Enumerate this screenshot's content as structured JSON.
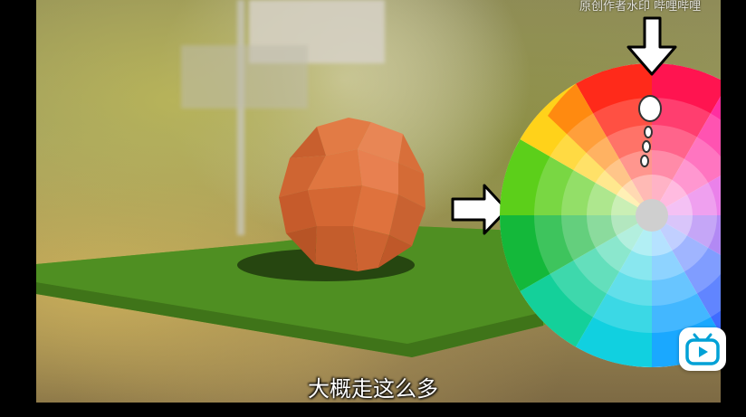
{
  "player": {
    "subtitle": "大概走这么多",
    "watermark": "原创作者水印 哔哩哔哩",
    "bilibili_button_label": "bilibili"
  },
  "colors": {
    "ground": "#4f8f22",
    "sphere": "#d9703a",
    "subtitle_text": "#ffffff",
    "brand_blue": "#00a1d6"
  }
}
